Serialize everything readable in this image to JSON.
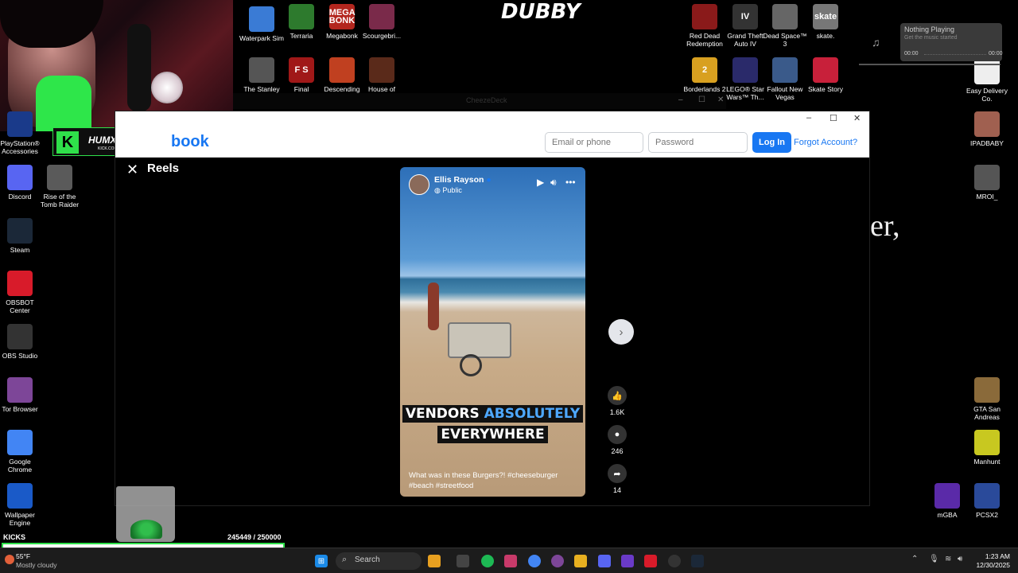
{
  "desktop": {
    "top_icons": [
      {
        "label": "Waterpark Sim",
        "color": "#3a7bd5"
      },
      {
        "label": "Terraria",
        "color": "#2d7a2d"
      },
      {
        "label": "Megabonk",
        "color": "#b3261e",
        "glyph": "MEGA BONK"
      },
      {
        "label": "Scourgebri...",
        "color": "#7a2a4a"
      },
      {
        "label": "The Stanley",
        "color": "#555555"
      },
      {
        "label": "Final",
        "color": "#a01818",
        "glyph": "F S"
      },
      {
        "label": "Descending",
        "color": "#c04020"
      },
      {
        "label": "House of",
        "color": "#5a2a1a"
      }
    ],
    "right_icons": [
      {
        "label": "Red Dead Redemption",
        "color": "#8a1a1a"
      },
      {
        "label": "Grand Theft Auto IV",
        "color": "#333333",
        "glyph": "IV"
      },
      {
        "label": "Dead Space™ 3",
        "color": "#666666"
      },
      {
        "label": "skate.",
        "color": "#777777",
        "glyph": "skate"
      },
      {
        "label": "Borderlands 2",
        "color": "#d8a020",
        "glyph": "2"
      },
      {
        "label": "LEGO® Star Wars™ Th...",
        "color": "#2a2a6a"
      },
      {
        "label": "Fallout New Vegas",
        "color": "#3a5a8a"
      },
      {
        "label": "Skate Story",
        "color": "#c8203a"
      }
    ],
    "left_icons": [
      {
        "label": "PlayStation® Accessories",
        "color": "#1a3a8a"
      },
      {
        "label": "Discord",
        "color": "#5865f2"
      },
      {
        "label": "Rise of the Tomb Raider",
        "color": "#5a5a5a"
      },
      {
        "label": "Steam",
        "color": "#1b2838"
      },
      {
        "label": "OBSBOT Center",
        "color": "#d81b2a"
      },
      {
        "label": "OBS Studio",
        "color": "#333333"
      },
      {
        "label": "Tor Browser",
        "color": "#7d4698"
      },
      {
        "label": "Google Chrome",
        "color": "#4285f4"
      },
      {
        "label": "Wallpaper Engine",
        "color": "#1a5ac8"
      }
    ],
    "far_right_icons": [
      {
        "label": "Easy Delivery Co.",
        "color": "#eeeeee"
      },
      {
        "label": "IPADBABY",
        "color": "#a06050"
      },
      {
        "label": "MROI_",
        "color": "#555555"
      },
      {
        "label": "GTA San Andreas",
        "color": "#8a6a3a"
      },
      {
        "label": "Manhunt",
        "color": "#c8c820"
      },
      {
        "label": "mGBA",
        "color": "#5a2aa8"
      },
      {
        "label": "PCSX2",
        "color": "#2a4a9a"
      }
    ],
    "logo_text": "DUBBY",
    "overlay_tag": "HUMXNGHXST",
    "overlay_sub": "KICK.COM/HUMXNGHXST",
    "ghost_title": "CheezeDeck",
    "big_text": "er,"
  },
  "music": {
    "title": "Nothing Playing",
    "subtitle": "Get the music started",
    "time_start": "00:00",
    "time_end": "00:00"
  },
  "facebook": {
    "logo": "book",
    "email_placeholder": "Email or phone",
    "password_placeholder": "Password",
    "login_label": "Log In",
    "forgot_label": "Forgot Account?",
    "reels_title": "Reels",
    "video": {
      "author": "Ellis Rayson",
      "visibility": "Public",
      "caption_line1_a": "VENDORS",
      "caption_line1_b": "ABSOLUTELY",
      "caption_line2": "EVERYWHERE",
      "description": "What was in these Burgers?! #cheeseburger #beach #streetfood"
    },
    "actions": [
      {
        "icon": "like-icon",
        "glyph": "👍",
        "count": "1.6K"
      },
      {
        "icon": "comment-icon",
        "glyph": "●",
        "count": "246"
      },
      {
        "icon": "share-icon",
        "glyph": "➦",
        "count": "14"
      }
    ]
  },
  "kicks": {
    "label": "KICKS",
    "count": "245449  / 250000",
    "progress": 0.982
  },
  "taskbar": {
    "temp": "55°F",
    "weather": "Mostly cloudy",
    "search": "Search",
    "time": "1:23 AM",
    "date": "12/30/2025"
  }
}
